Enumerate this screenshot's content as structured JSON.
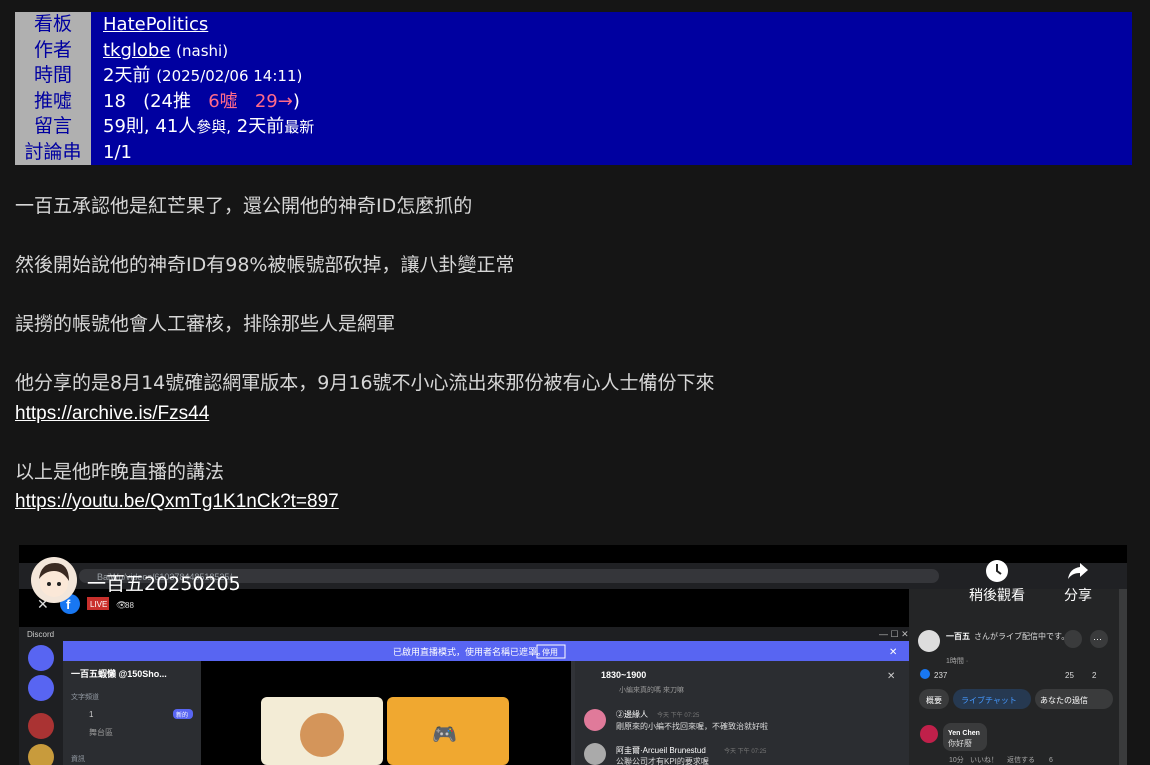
{
  "meta": {
    "labels": [
      "看板",
      "作者",
      "時間",
      "推噓",
      "留言",
      "討論串"
    ],
    "board": "HatePolitics",
    "author_id": "tkglobe",
    "author_nick": "(nashi)",
    "time_ago": "2天前",
    "time_full": "(2025/02/06 14:11)",
    "score": "18",
    "score_open": "(24推",
    "score_boo": "6噓",
    "score_arrow": "29→",
    "score_close": ")",
    "comments_count": "59則,",
    "comments_people": "41人",
    "comments_people_suffix": "參與,",
    "comments_latest": "2天前",
    "comments_latest_suffix": "最新",
    "thread": "1/1"
  },
  "article": {
    "line1": "一百五承認他是紅芒果了，還公開他的神奇ID怎麼抓的",
    "line2": "然後開始說他的神奇ID有98%被帳號部砍掉，讓八卦變正常",
    "line3": "誤撈的帳號他會人工審核，排除那些人是網軍",
    "line4": "他分享的是8月14號確認網軍版本，9月16號不小心流出來那份被有心人士備份下來",
    "link1": "https://archive.is/Fzs44",
    "line5": "以上是他昨晚直播的講法",
    "link2": "https://youtu.be/QxmTg1K1nCk?t=897"
  },
  "video": {
    "title": "一百五20250205",
    "watch_later": "稍後觀看",
    "share": "分享",
    "embedded": {
      "url": "BaiWu/videos/610378448518525/",
      "live_badge": "LIVE",
      "viewers": "88",
      "discord_label": "Discord",
      "banner": "已啟用直播模式，使用者名稱已遮罩。",
      "banner_button": "停用",
      "server_name": "一百五蝦懶 @150Sho...",
      "text_channels": "文字頻道",
      "channel_1": "1",
      "channel_badge": "新的",
      "channel_stage": "舞台區",
      "category_2": "資訊",
      "thread_name": "1830~1900",
      "thread_first": "小編來真的嗎 來刀嘛",
      "msg1_user": "②邊緣人",
      "msg1_time": "今天 下午 07:25",
      "msg1_text": "剛原來的小編不找回來喔，不確致治就好啦",
      "msg2_user": "阿圭爾·Arcueil Brunestud",
      "msg2_time": "今天 下午 07:25",
      "msg2_text": "公聯公司才有KPI的要求喔",
      "fb_page": "一百五",
      "fb_status": "さんがライブ配信中です。",
      "fb_time": "1時間 ·",
      "fb_reactions": "237",
      "fb_comments": "25",
      "fb_shares": "2",
      "tab_overview": "概要",
      "tab_chat": "ライブチャット",
      "tab_yours": "あなたの過信",
      "commenter": "Yen Chen",
      "comment": "你好廢",
      "comment_time": "10分",
      "comment_like": "いいね！",
      "comment_reply": "返信する",
      "comment_reacts": "6"
    },
    "colors": {
      "discord_purple": "#5865f2",
      "discord_bg": "#313338",
      "discord_sidebar": "#2b2d31",
      "fb_blue": "#1877f2"
    }
  }
}
